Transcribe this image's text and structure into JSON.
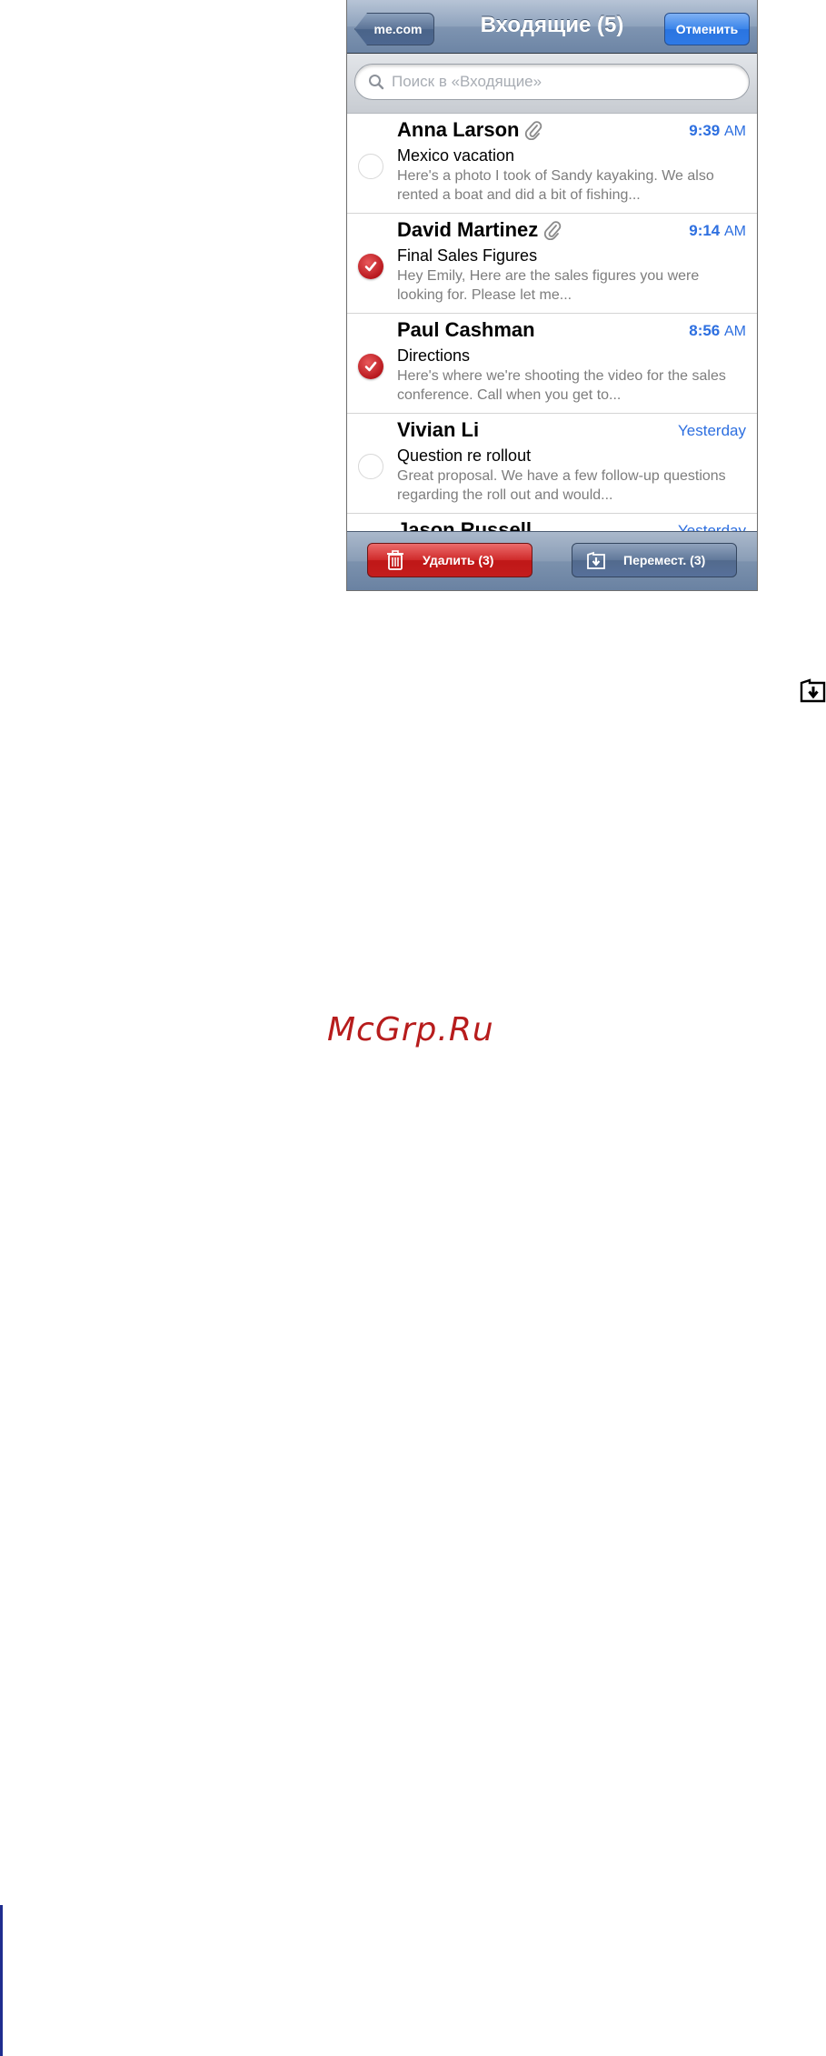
{
  "navbar": {
    "back_label": "me.com",
    "title": "Входящие (5)",
    "cancel_label": "Отменить"
  },
  "search": {
    "placeholder": "Поиск в «Входящие»"
  },
  "messages": [
    {
      "sender": "Anna Larson",
      "has_attachment": true,
      "time": "9:39",
      "ampm": "AM",
      "subject": "Mexico vacation",
      "preview": "Here's a photo I took of Sandy kayaking. We also rented a boat and did a bit of fishing...",
      "checked": false
    },
    {
      "sender": "David Martinez",
      "has_attachment": true,
      "time": "9:14",
      "ampm": "AM",
      "subject": "Final Sales Figures",
      "preview": "Hey Emily, Here are the sales figures you were looking for. Please let me...",
      "checked": true
    },
    {
      "sender": "Paul Cashman",
      "has_attachment": false,
      "time": "8:56",
      "ampm": "AM",
      "subject": "Directions",
      "preview": "Here's where we're shooting the video for the sales conference. Call when you get to...",
      "checked": true
    },
    {
      "sender": "Vivian Li",
      "has_attachment": false,
      "time": "Yesterday",
      "ampm": "",
      "subject": "Question re rollout",
      "preview": "Great proposal. We have a few follow-up questions regarding the roll out and would...",
      "checked": false
    },
    {
      "sender": "Jason Russell",
      "has_attachment": false,
      "time": "Yesterday",
      "ampm": "",
      "subject": "",
      "preview": "",
      "checked": false
    }
  ],
  "toolbar": {
    "delete_label": "Удалить (3)",
    "move_label": "Перемест. (3)"
  },
  "icons": {
    "back": "chevron-left-icon",
    "search": "magnifier-icon",
    "attachment": "paperclip-icon",
    "checkmark": "checkmark-icon",
    "trash": "trash-icon",
    "move": "folder-arrow-icon"
  },
  "colors": {
    "navbar": "#7e94b1",
    "accent_blue": "#2d6fe0",
    "delete_red": "#c41d1d",
    "check_red": "#b5141a"
  },
  "watermark": "McGrp.Ru"
}
